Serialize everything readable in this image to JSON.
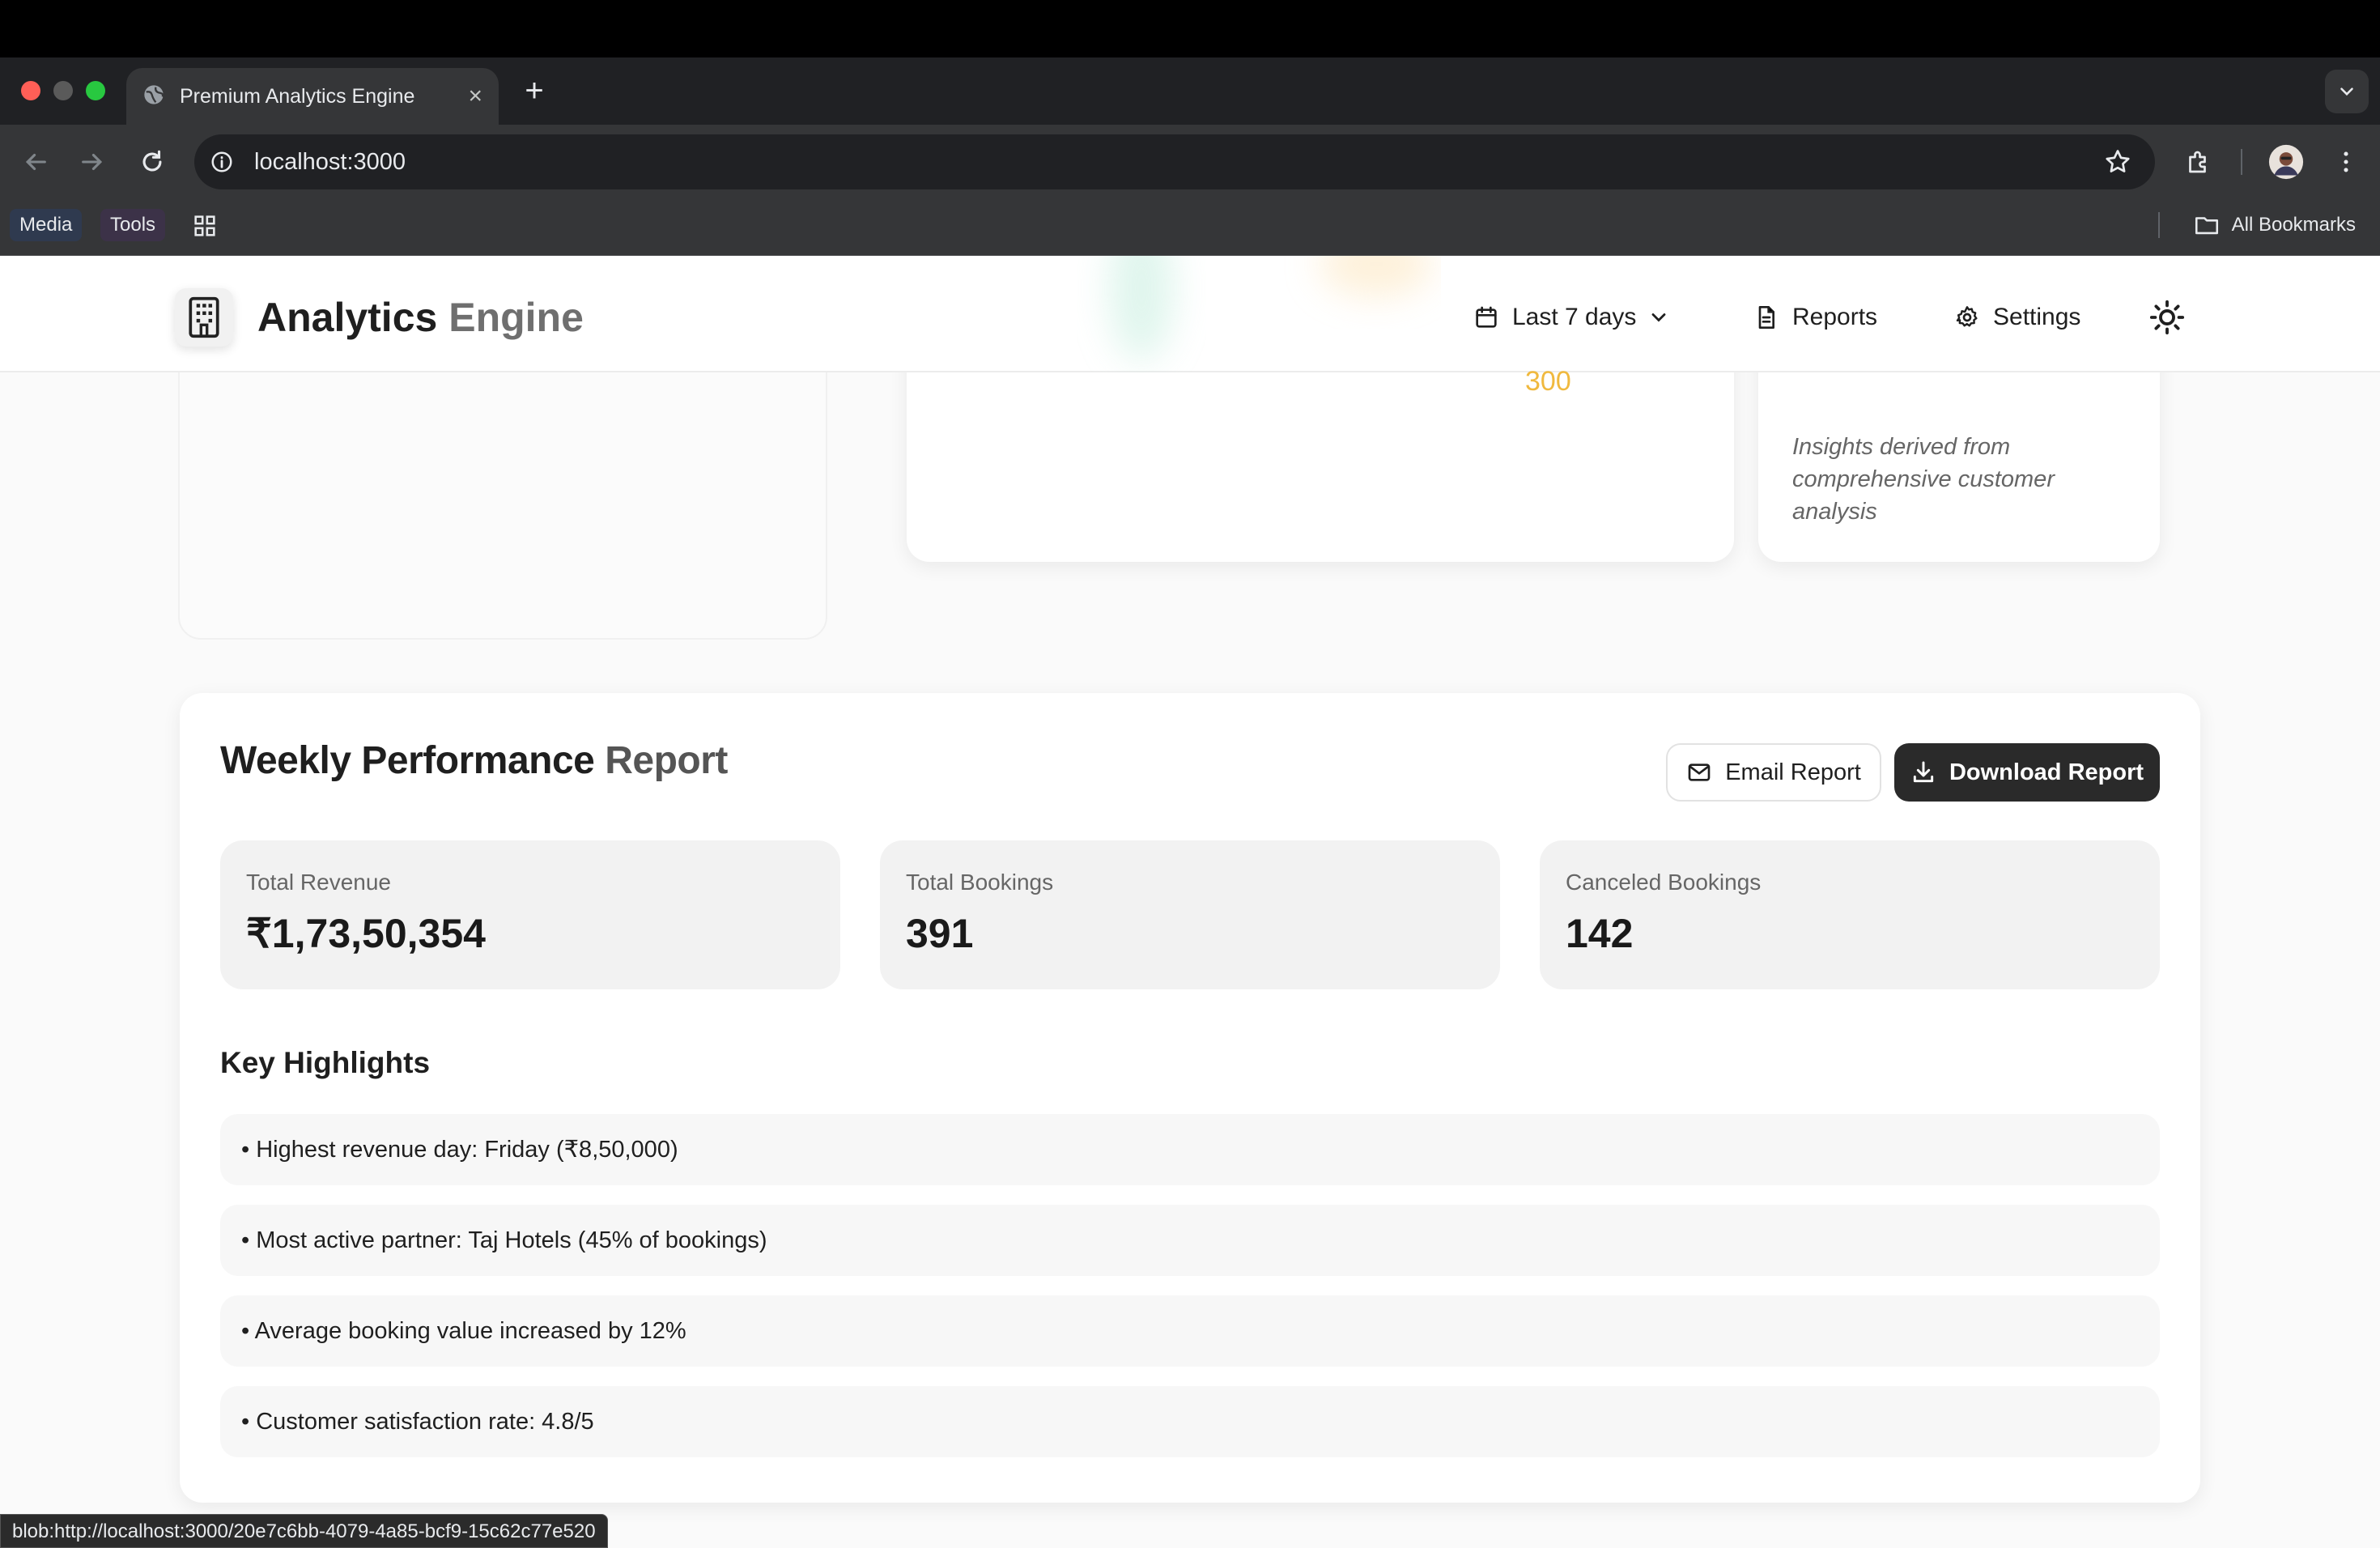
{
  "browser": {
    "tab_title": "Premium Analytics Engine",
    "url": "localhost:3000",
    "bookmarks": [
      "Media",
      "Tools"
    ],
    "all_bookmarks_label": "All Bookmarks",
    "status_url": "blob:http://localhost:3000/20e7c6bb-4079-4a85-bcf9-15c62c77e520"
  },
  "header": {
    "brand_main": "Analytics",
    "brand_accent": "Engine",
    "date_range": "Last 7 days",
    "reports_label": "Reports",
    "settings_label": "Settings"
  },
  "donut": {
    "visible_label": "300",
    "colors": {
      "teal": "#5bc3a2",
      "amber": "#f3bd4a"
    }
  },
  "insight_text": "Insights derived from comprehensive customer analysis",
  "report": {
    "title_main": "Weekly Performance",
    "title_accent": "Report",
    "email_label": "Email Report",
    "download_label": "Download Report",
    "stats": [
      {
        "label": "Total Revenue",
        "value": "₹1,73,50,354"
      },
      {
        "label": "Total Bookings",
        "value": "391"
      },
      {
        "label": "Canceled Bookings",
        "value": "142"
      }
    ],
    "highlights_title": "Key Highlights",
    "highlights": [
      "• Highest revenue day: Friday (₹8,50,000)",
      "• Most active partner: Taj Hotels (45% of bookings)",
      "• Average booking value increased by 12%",
      "• Customer satisfaction rate: 4.8/5"
    ]
  }
}
